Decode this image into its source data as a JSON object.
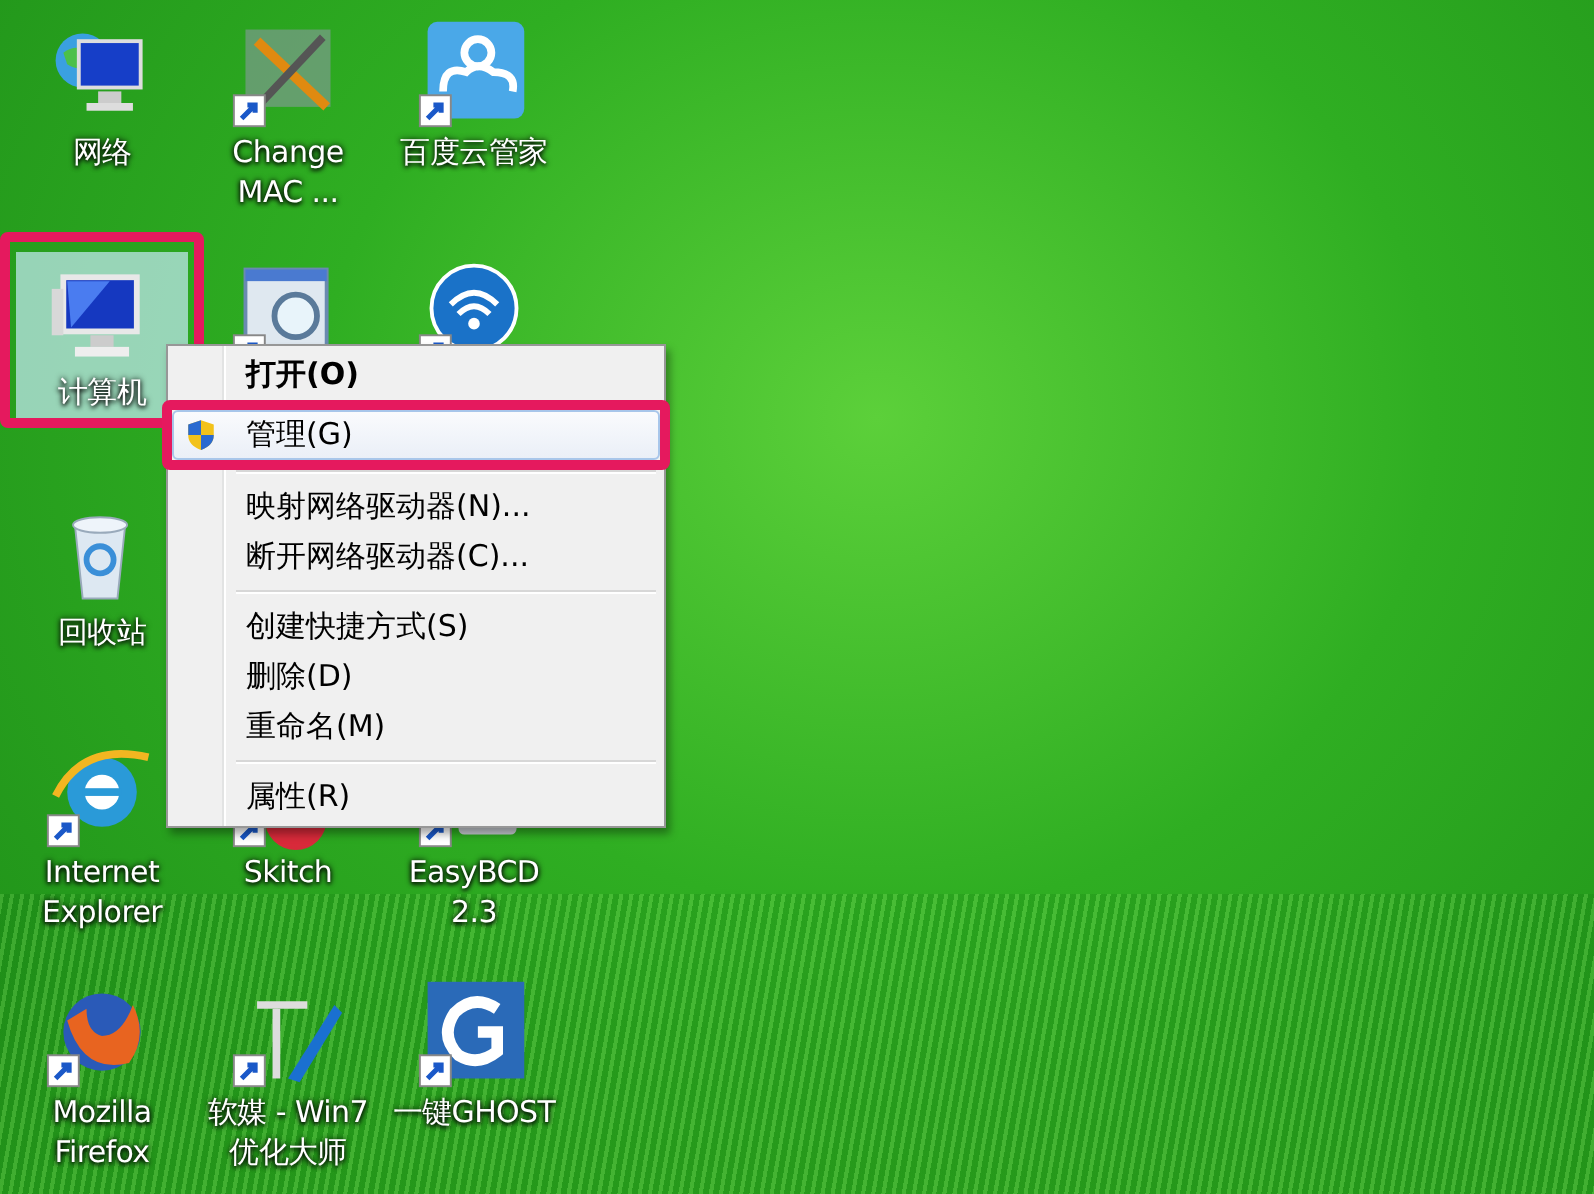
{
  "desktop": {
    "columns": [
      [
        {
          "kind": "network",
          "label": "网络",
          "shortcut": false,
          "selected": false,
          "annotated": false
        },
        {
          "kind": "computer",
          "label": "计算机",
          "shortcut": false,
          "selected": true,
          "annotated": true
        },
        {
          "kind": "recycle",
          "label": "回收站",
          "shortcut": false,
          "selected": false,
          "annotated": false
        },
        {
          "kind": "ie",
          "label": "Internet Explorer",
          "shortcut": true,
          "selected": false,
          "annotated": false
        },
        {
          "kind": "firefox",
          "label": "Mozilla Firefox",
          "shortcut": true,
          "selected": false,
          "annotated": false
        }
      ],
      [
        {
          "kind": "tools",
          "label": "Change MAC ...",
          "shortcut": true,
          "selected": false,
          "annotated": false
        },
        {
          "kind": "viewer",
          "shortcut": true,
          "selected": false,
          "annotated": false
        },
        {
          "kind": "skitch",
          "label": "Skitch",
          "shortcut": true,
          "selected": false,
          "annotated": false
        },
        {
          "kind": "knife",
          "label": "软媒 - Win7 优化大师",
          "shortcut": true,
          "selected": false,
          "annotated": false
        }
      ],
      [
        {
          "kind": "cloud",
          "label": "百度云管家",
          "shortcut": true,
          "selected": false,
          "annotated": false
        },
        {
          "kind": "wifi",
          "shortcut": true,
          "selected": false,
          "annotated": false
        },
        {
          "kind": "disk",
          "label": "EasyBCD 2.3",
          "shortcut": true,
          "selected": false,
          "annotated": false
        },
        {
          "kind": "ghost",
          "label": "一键GHOST",
          "shortcut": true,
          "selected": false,
          "annotated": false
        }
      ]
    ]
  },
  "context_menu": {
    "items": [
      {
        "kind": "item",
        "label": "打开(O)",
        "default": true,
        "selected": false,
        "annotated": false,
        "shield": false
      },
      {
        "kind": "item",
        "label": "管理(G)",
        "default": false,
        "selected": true,
        "annotated": true,
        "shield": true
      },
      {
        "kind": "separator"
      },
      {
        "kind": "item",
        "label": "映射网络驱动器(N)...",
        "default": false,
        "selected": false,
        "annotated": false,
        "shield": false
      },
      {
        "kind": "item",
        "label": "断开网络驱动器(C)...",
        "default": false,
        "selected": false,
        "annotated": false,
        "shield": false
      },
      {
        "kind": "separator"
      },
      {
        "kind": "item",
        "label": "创建快捷方式(S)",
        "default": false,
        "selected": false,
        "annotated": false,
        "shield": false
      },
      {
        "kind": "item",
        "label": "删除(D)",
        "default": false,
        "selected": false,
        "annotated": false,
        "shield": false
      },
      {
        "kind": "item",
        "label": "重命名(M)",
        "default": false,
        "selected": false,
        "annotated": false,
        "shield": false
      },
      {
        "kind": "separator"
      },
      {
        "kind": "item",
        "label": "属性(R)",
        "default": false,
        "selected": false,
        "annotated": false,
        "shield": false
      }
    ]
  }
}
